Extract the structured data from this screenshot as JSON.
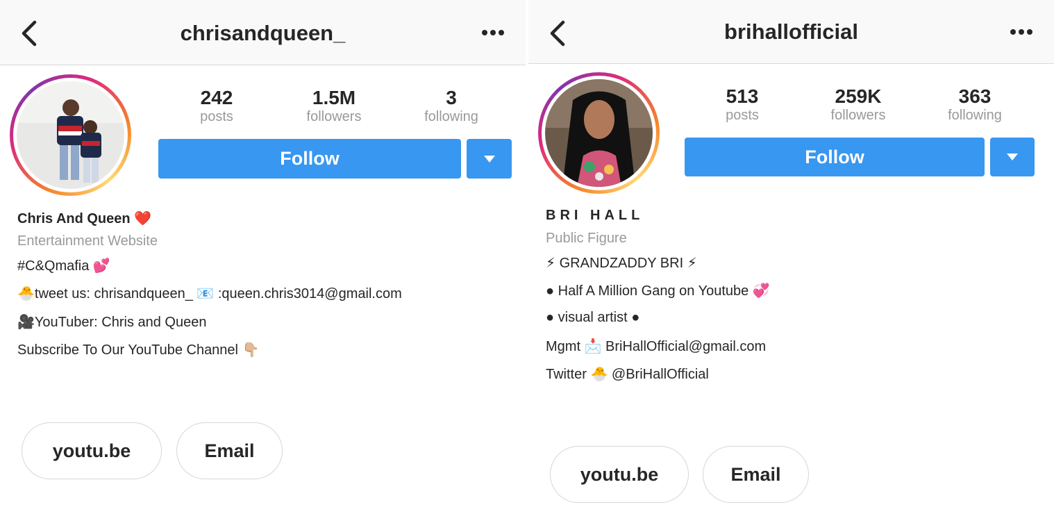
{
  "left": {
    "username": "chrisandqueen_",
    "stats": [
      {
        "value": "242",
        "label": "posts"
      },
      {
        "value": "1.5M",
        "label": "followers"
      },
      {
        "value": "3",
        "label": "following"
      }
    ],
    "follow_label": "Follow",
    "bio": {
      "name": "Chris And Queen ❤️",
      "category": "Entertainment Website",
      "lines": [
        "#C&Qmafia 💕",
        "🐣tweet us: chrisandqueen_ 📧 :queen.chris3014@gmail.com",
        "🎥YouTuber: Chris and Queen",
        "Subscribe To Our YouTube Channel 👇🏼"
      ]
    },
    "buttons": [
      "youtu.be",
      "Email"
    ]
  },
  "right": {
    "username": "brihallofficial",
    "stats": [
      {
        "value": "513",
        "label": "posts"
      },
      {
        "value": "259K",
        "label": "followers"
      },
      {
        "value": "363",
        "label": "following"
      }
    ],
    "follow_label": "Follow",
    "bio": {
      "name": "BRI HALL",
      "category": "Public Figure",
      "lines": [
        "⚡ GRANDZADDY BRI ⚡",
        "● Half A Million Gang on Youtube 💞",
        "● visual artist ●",
        "Mgmt 📩 BriHallOfficial@gmail.com",
        "Twitter 🐣 @BriHallOfficial"
      ]
    },
    "buttons": [
      "youtu.be",
      "Email"
    ]
  },
  "icons": [
    "back-chevron-icon",
    "more-options-icon",
    "dropdown-arrow-icon"
  ],
  "colors": {
    "follow_blue": "#3897f0",
    "secondary_text": "#999999",
    "primary_text": "#262626"
  }
}
